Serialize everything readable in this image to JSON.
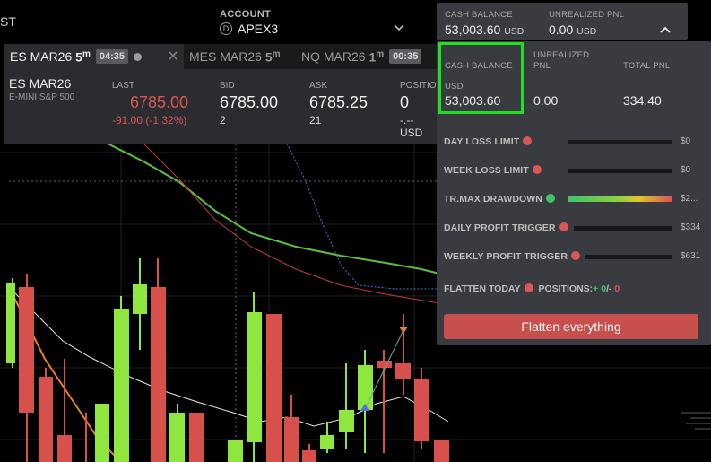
{
  "topbar": {
    "left_text": "ST",
    "account_label": "ACCOUNT",
    "account_badge": "D",
    "account_value": "APEX3"
  },
  "balance_header": {
    "cash_label": "CASH BALANCE",
    "cash_value": "53,003.60",
    "cash_unit": "USD",
    "upnl_label": "UNREALIZED PNL",
    "upnl_value": "0.00",
    "upnl_unit": "USD"
  },
  "tabs": [
    {
      "symbol": "ES MAR26",
      "tf": "5",
      "tf_unit": "m",
      "time": "04:35"
    },
    {
      "symbol": "MES MAR26",
      "tf": "5",
      "tf_unit": "m"
    },
    {
      "symbol": "NQ MAR26",
      "tf": "1",
      "tf_unit": "m",
      "time": "00:35"
    }
  ],
  "quote": {
    "symbol": "ES MAR26",
    "description": "E-MINI S&P 500",
    "last_label": "LAST",
    "last_value": "6785.00",
    "last_change": "-91.00 (-1.32%)",
    "bid_label": "BID",
    "bid_value": "6785.00",
    "bid_size": "2",
    "ask_label": "ASK",
    "ask_value": "6785.25",
    "ask_size": "21",
    "position_label": "POSITIO",
    "position_value": "0",
    "position_sub": "-.-- USD"
  },
  "panel": {
    "cash_label": "CASH BALANCE",
    "cash_unit": "USD",
    "cash_value": "53,003.60",
    "upnl_label_1": "UNREALIZED",
    "upnl_label_2": "PNL",
    "upnl_value": "0.00",
    "total_label": "TOTAL PNL",
    "total_value": "334.40",
    "limits": [
      {
        "label": "DAY LOSS LIMIT",
        "value": "$0",
        "dot": "#d95757"
      },
      {
        "label": "WEEK LOSS LIMIT",
        "value": "$0",
        "dot": "#d95757"
      },
      {
        "label": "TR.MAX DRAWDOWN",
        "value": "$2...",
        "dot": "#41c36b"
      },
      {
        "label": "DAILY PROFIT TRIGGER",
        "value": "$334",
        "dot": "#d95757"
      },
      {
        "label": "WEEKLY PROFIT TRIGGER",
        "value": "$631",
        "dot": "#d95757"
      }
    ],
    "flatten_today_label": "FLATTEN TODAY",
    "positions_label": "POSITIONS:",
    "positions_long": "+ 0",
    "positions_sep": "/-",
    "positions_short": "0",
    "flatten_button": "Flatten everything"
  },
  "colors": {
    "accent_green": "#21e021",
    "bull_candle": "#8ee63f",
    "bear_candle": "#d8504c",
    "panel_bg": "#3a3b40",
    "flatten_button": "#c8504c"
  }
}
